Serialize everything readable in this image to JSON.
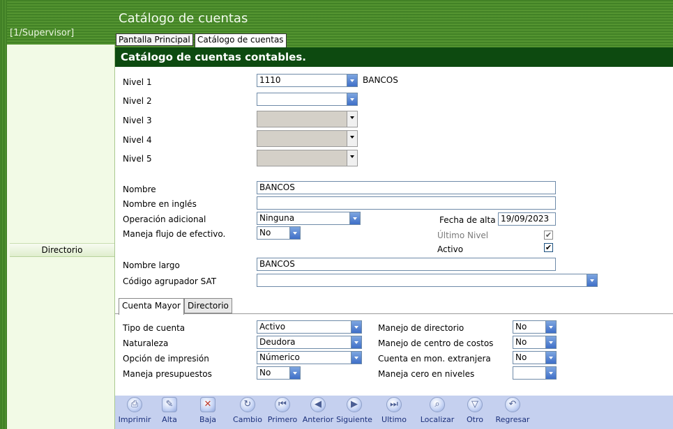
{
  "app": {
    "title": "Catálogo de cuentas",
    "user": "[1/Supervisor]"
  },
  "tabs": [
    "Pantalla Principal",
    "Catálogo de cuentas"
  ],
  "sidebar": {
    "directorio": "Directorio"
  },
  "section_title": "Catálogo de cuentas contables.",
  "niveles": {
    "labels": [
      "Nivel 1",
      "Nivel 2",
      "Nivel 3",
      "Nivel 4",
      "Nivel 5"
    ],
    "nivel1_value": "1110",
    "nivel1_desc": "BANCOS"
  },
  "form": {
    "nombre_label": "Nombre",
    "nombre_value": "BANCOS",
    "nombre_ingles_label": "Nombre en inglés",
    "nombre_ingles_value": "",
    "operacion_label": "Operación adicional",
    "operacion_value": "Ninguna",
    "flujo_label": "Maneja flujo de efectivo.",
    "flujo_value": "No",
    "fecha_alta_label": "Fecha de alta",
    "fecha_alta_value": "19/09/2023",
    "ultimo_nivel_label": "Último Nivel",
    "ultimo_nivel_checked": "✔",
    "activo_label": "Activo",
    "activo_checked": "✔",
    "nombre_largo_label": "Nombre largo",
    "nombre_largo_value": "BANCOS",
    "sat_label": "Código agrupador SAT",
    "sat_value": ""
  },
  "subtabs": [
    "Cuenta Mayor",
    "Directorio"
  ],
  "cuenta_mayor": {
    "tipo_label": "Tipo de cuenta",
    "tipo_value": "Activo",
    "naturaleza_label": "Naturaleza",
    "naturaleza_value": "Deudora",
    "impresion_label": "Opción de impresión",
    "impresion_value": "Númerico",
    "presupuestos_label": "Maneja presupuestos",
    "presupuestos_value": "No",
    "directorio_label": "Manejo de directorio",
    "directorio_value": "No",
    "costos_label": "Manejo de centro de costos",
    "costos_value": "No",
    "extranjera_label": "Cuenta en mon. extranjera",
    "extranjera_value": "No",
    "cero_label": "Maneja cero en niveles",
    "cero_value": ""
  },
  "toolbar": [
    {
      "label": "Imprimir",
      "icon": "printer-icon",
      "glyph": "⎙"
    },
    {
      "label": "Alta",
      "icon": "new-doc-icon",
      "glyph": "✎"
    },
    {
      "label": "Baja",
      "icon": "delete-icon",
      "glyph": "✕"
    },
    {
      "label": "Cambio",
      "icon": "refresh-icon",
      "glyph": "↻"
    },
    {
      "label": "Primero",
      "icon": "first-icon",
      "glyph": "⏮"
    },
    {
      "label": "Anterior",
      "icon": "previous-icon",
      "glyph": "◀"
    },
    {
      "label": "Siguiente",
      "icon": "next-icon",
      "glyph": "▶"
    },
    {
      "label": "Ultimo",
      "icon": "last-icon",
      "glyph": "⏭"
    },
    {
      "label": "Localizar",
      "icon": "search-icon",
      "glyph": "⌕"
    },
    {
      "label": "Otro",
      "icon": "other-icon",
      "glyph": "▽"
    },
    {
      "label": "Regresar",
      "icon": "back-icon",
      "glyph": "↶"
    }
  ]
}
